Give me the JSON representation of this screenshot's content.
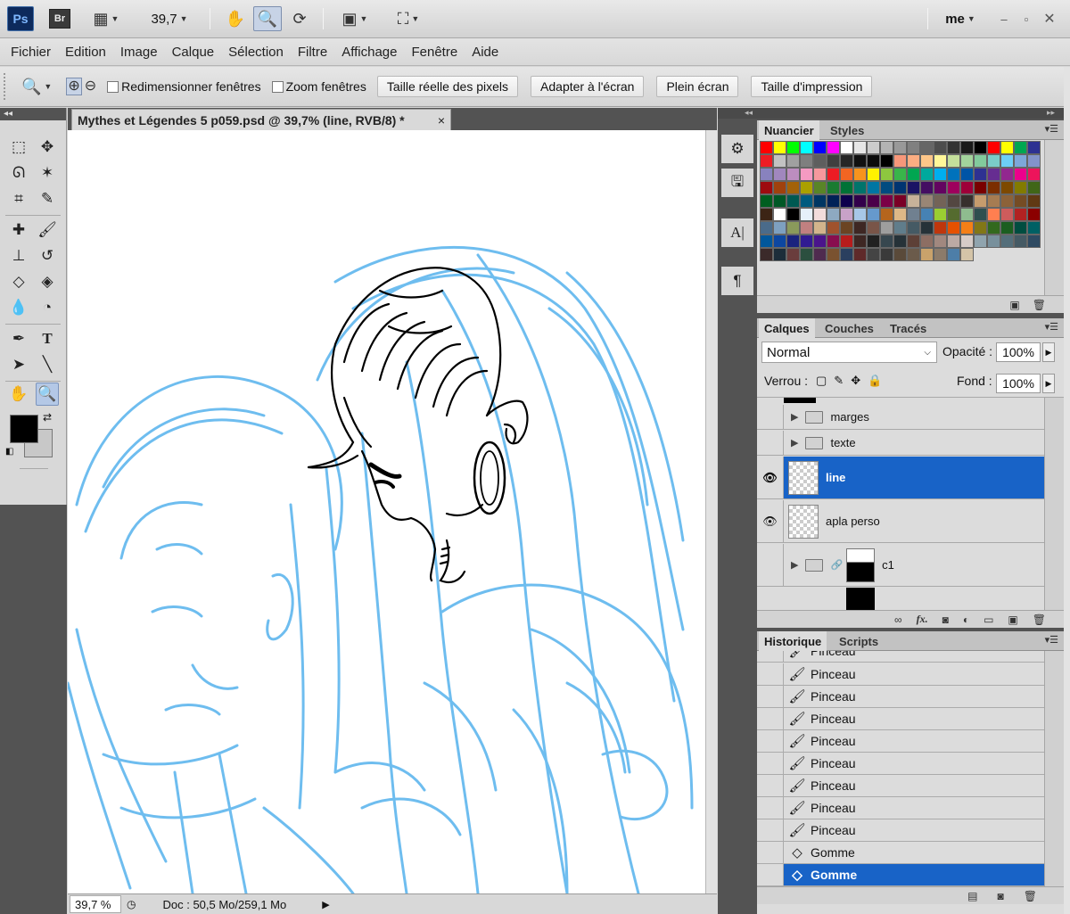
{
  "appbar": {
    "ps_logo": "Ps",
    "br_logo": "Br",
    "zoom_value": "39,7",
    "workspace": "me",
    "icons": [
      "view-extras-icon",
      "hand-tool-icon",
      "zoom-tool-icon",
      "rotate-view-icon",
      "arrange-documents-icon",
      "screen-mode-icon"
    ],
    "window_controls": [
      "minimize-icon",
      "maximize-icon",
      "close-icon"
    ]
  },
  "menubar": {
    "items": [
      "Fichier",
      "Edition",
      "Image",
      "Calque",
      "Sélection",
      "Filtre",
      "Affichage",
      "Fenêtre",
      "Aide"
    ]
  },
  "options": {
    "resize_windows": "Redimensionner fenêtres",
    "zoom_all": "Zoom fenêtres",
    "actual_pixels": "Taille réelle des pixels",
    "fit_screen": "Adapter à l'écran",
    "fill_screen": "Plein écran",
    "print_size": "Taille d'impression"
  },
  "document": {
    "tab_title": "Mythes et Légendes  5 p059.psd @ 39,7% (line, RVB/8) *",
    "close": "×",
    "line_color": "#000000",
    "sketch_color": "#5fb6ee"
  },
  "status": {
    "zoom": "39,7 %",
    "doc_info": "Doc : 50,5 Mo/259,1 Mo"
  },
  "swatches_panel": {
    "tabs": [
      "Nuancier",
      "Styles"
    ],
    "colors": [
      "#ff0000",
      "#ffff00",
      "#00ff00",
      "#00ffff",
      "#0000ff",
      "#ff00ff",
      "#ffffff",
      "#e6e6e6",
      "#cccccc",
      "#b3b3b3",
      "#999999",
      "#808080",
      "#666666",
      "#4d4d4d",
      "#333333",
      "#1a1a1a",
      "#000000",
      "#ff0000",
      "#ffff00",
      "#00a651",
      "#2e3192",
      "#ed1c24",
      "#c2c2c2",
      "#a0a0a0",
      "#7f7f7f",
      "#5e5e5e",
      "#3f3f3f",
      "#262626",
      "#111111",
      "#0c0c0c",
      "#000000",
      "#f7977a",
      "#fbad82",
      "#fdc689",
      "#fff799",
      "#c4df9b",
      "#a3d39c",
      "#82ca9c",
      "#7accc8",
      "#6dcff6",
      "#7da7d9",
      "#8393ca",
      "#8882be",
      "#a187be",
      "#bc8dbf",
      "#f49ac2",
      "#f6989d",
      "#ed1c24",
      "#f26522",
      "#f7941d",
      "#fff200",
      "#8dc73f",
      "#39b54a",
      "#00a651",
      "#00a99d",
      "#00aeef",
      "#0072bc",
      "#0054a6",
      "#2e3192",
      "#662d91",
      "#92278f",
      "#ec008c",
      "#ed145b",
      "#9e0b0f",
      "#a0410d",
      "#a36209",
      "#aba000",
      "#598527",
      "#1a7b30",
      "#007236",
      "#00746b",
      "#0076a3",
      "#004b80",
      "#003471",
      "#1b1464",
      "#440e62",
      "#630460",
      "#9e005d",
      "#9e0039",
      "#790000",
      "#7b2e00",
      "#7d4900",
      "#827b00",
      "#406618",
      "#005e20",
      "#005826",
      "#005952",
      "#005b7f",
      "#003663",
      "#002157",
      "#0d004c",
      "#32004b",
      "#4b0049",
      "#7b0046",
      "#7a0026",
      "#c7b299",
      "#998675",
      "#736357",
      "#534741",
      "#37302d",
      "#c69c6d",
      "#a67c52",
      "#8c6239",
      "#754c24",
      "#603913",
      "#3c2415",
      "#ffffff",
      "#000000",
      "#e6f0fa",
      "#f2dcdb",
      "#8ea9c1",
      "#c8a2c8",
      "#a7c7e7",
      "#6699cc",
      "#b5651d",
      "#deb887",
      "#708090",
      "#4682b4",
      "#9acd32",
      "#556b2f",
      "#8fbc8f",
      "#2f4f4f",
      "#ff7f50",
      "#cd5c5c",
      "#b22222",
      "#8b0000",
      "#4a6b8a",
      "#7ea0c0",
      "#8a9a5b",
      "#c08080",
      "#d2b48c",
      "#a0522d",
      "#6b4423",
      "#3e2723",
      "#795548",
      "#9e9e9e",
      "#607d8b",
      "#455a64",
      "#263238",
      "#bf360c",
      "#e65100",
      "#f57f17",
      "#827717",
      "#33691e",
      "#1b5e20",
      "#004d40",
      "#006064",
      "#01579b",
      "#0d47a1",
      "#1a237e",
      "#311b92",
      "#4a148c",
      "#880e4f",
      "#b71c1c",
      "#3e2723",
      "#212121",
      "#37474f",
      "#263238",
      "#5d4037",
      "#8d6e63",
      "#a1887f",
      "#bcaaa4",
      "#d7ccc8",
      "#90a4ae",
      "#78909c",
      "#546e7a",
      "#455a64",
      "#2e4a62",
      "#3b2a2a",
      "#1d2d3a",
      "#6a3d3d",
      "#2b4f3f",
      "#4f2b4f",
      "#7a5230",
      "#2a3f5f",
      "#5f2a2a",
      "#444444",
      "#3a3a3a",
      "#5a4a3a",
      "#6b5b4b",
      "#c9a26b",
      "#8c7b6a",
      "#4d7ea8",
      "#d4c4a8"
    ]
  },
  "layers_panel": {
    "tabs": [
      "Calques",
      "Couches",
      "Tracés"
    ],
    "blend_mode": "Normal",
    "opacity_label": "Opacité :",
    "opacity_value": "100%",
    "lock_label": "Verrou :",
    "fill_label": "Fond :",
    "fill_value": "100%",
    "layers": [
      {
        "name": "marges",
        "kind": "group",
        "visible": false
      },
      {
        "name": "texte",
        "kind": "group",
        "visible": false
      },
      {
        "name": "line",
        "kind": "layer",
        "visible": true,
        "selected": true
      },
      {
        "name": "apla perso",
        "kind": "layer",
        "visible": true
      },
      {
        "name": "c1",
        "kind": "group-mask",
        "visible": false
      }
    ],
    "footer_icons": [
      "link-layers-icon",
      "fx-icon",
      "add-mask-icon",
      "adjustment-layer-icon",
      "new-group-icon",
      "new-layer-icon",
      "delete-layer-icon"
    ],
    "fx_label": "fx."
  },
  "history_panel": {
    "tabs": [
      "Historique",
      "Scripts"
    ],
    "items": [
      {
        "label": "Pinceau",
        "icon": "brush-icon"
      },
      {
        "label": "Pinceau",
        "icon": "brush-icon"
      },
      {
        "label": "Pinceau",
        "icon": "brush-icon"
      },
      {
        "label": "Pinceau",
        "icon": "brush-icon"
      },
      {
        "label": "Pinceau",
        "icon": "brush-icon"
      },
      {
        "label": "Pinceau",
        "icon": "brush-icon"
      },
      {
        "label": "Pinceau",
        "icon": "brush-icon"
      },
      {
        "label": "Pinceau",
        "icon": "brush-icon"
      },
      {
        "label": "Pinceau",
        "icon": "brush-icon"
      },
      {
        "label": "Gomme",
        "icon": "eraser-icon"
      },
      {
        "label": "Gomme",
        "icon": "eraser-icon",
        "selected": true
      }
    ],
    "footer_icons": [
      "new-document-from-state-icon",
      "snapshot-icon",
      "delete-state-icon"
    ]
  }
}
